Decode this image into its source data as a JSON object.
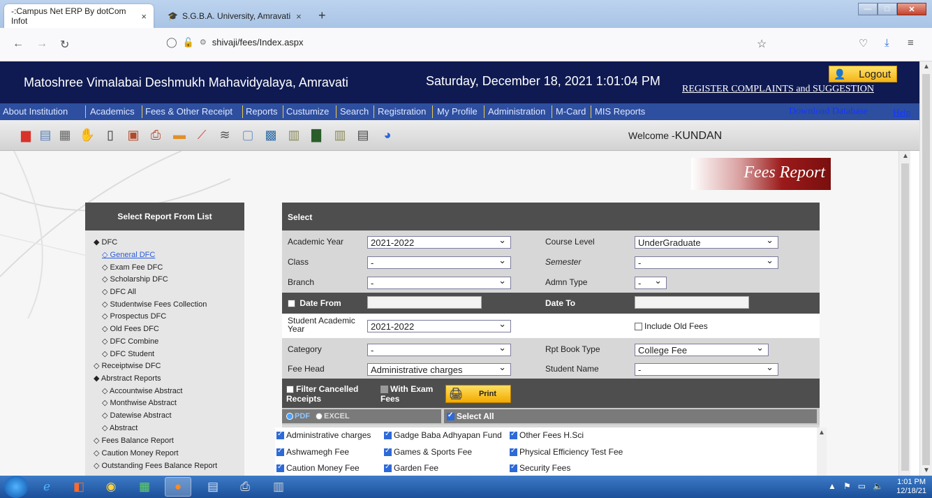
{
  "browser": {
    "tabs": [
      {
        "label": "-:Campus Net ERP By dotCom Infot",
        "close": "×"
      },
      {
        "label": "S.G.B.A. University, Amravati",
        "close": "×"
      }
    ],
    "new_tab": "+",
    "url": "shivaji/fees/Index.aspx"
  },
  "header": {
    "college": "Matoshree Vimalabai Deshmukh Mahavidyalaya, Amravati",
    "datetime": "Saturday, December 18, 2021 1:01:04 PM",
    "complaints": "REGISTER COMPLAINTS and SUGGESTION",
    "logout": "Logout"
  },
  "menu": {
    "items": [
      "About Institution",
      "Academics",
      "Fees & Other Receipt",
      "Reports",
      "Custumize",
      "Search",
      "Registration",
      "My Profile",
      "Administration",
      "M-Card",
      "MIS Reports"
    ],
    "download": "Download Database",
    "help": "Help"
  },
  "toolbar": {
    "welcome_prefix": "Welcome -",
    "user": "KUNDAN"
  },
  "page": {
    "title": "Fees Report"
  },
  "left_panel": {
    "title": "Select Report From List",
    "items": [
      {
        "label": "DFC",
        "bullet": "◆"
      },
      {
        "label": "General DFC",
        "bullet": "◇"
      },
      {
        "label": "Exam Fee DFC",
        "bullet": "◇"
      },
      {
        "label": "Scholarship DFC",
        "bullet": "◇"
      },
      {
        "label": "DFC All",
        "bullet": "◇"
      },
      {
        "label": "Studentwise Fees Collection",
        "bullet": "◇"
      },
      {
        "label": "Prospectus DFC",
        "bullet": "◇"
      },
      {
        "label": "Old Fees DFC",
        "bullet": "◇"
      },
      {
        "label": "DFC Combine",
        "bullet": "◇"
      },
      {
        "label": "DFC Student",
        "bullet": "◇"
      },
      {
        "label": "Receiptwise DFC",
        "bullet": "◇"
      },
      {
        "label": "Abrstract Reports",
        "bullet": "◆"
      },
      {
        "label": "Accountwise Abstract",
        "bullet": "◇"
      },
      {
        "label": "Monthwise Abstract",
        "bullet": "◇"
      },
      {
        "label": "Datewise Abstract",
        "bullet": "◇"
      },
      {
        "label": "Abstract",
        "bullet": "◇"
      },
      {
        "label": "Fees Balance Report",
        "bullet": "◇"
      },
      {
        "label": "Caution Money Report",
        "bullet": "◇"
      },
      {
        "label": "Outstanding Fees Balance Report",
        "bullet": "◇"
      }
    ]
  },
  "form": {
    "title": "Select",
    "academic_year": {
      "label": "Academic Year",
      "value": "2021-2022"
    },
    "course_level": {
      "label": "Course Level",
      "value": "UnderGraduate"
    },
    "class": {
      "label": "Class",
      "value": "-"
    },
    "semester": {
      "label": "Semester",
      "value": "-"
    },
    "branch": {
      "label": "Branch",
      "value": "-"
    },
    "admn_type": {
      "label": "Admn Type",
      "value": "-"
    },
    "date_from": {
      "label": "Date From"
    },
    "date_to": {
      "label": "Date To"
    },
    "student_academic_year": {
      "label": "Student Academic Year",
      "value": "2021-2022"
    },
    "include_old_fees": "Include Old Fees",
    "category": {
      "label": "Category",
      "value": "-"
    },
    "rpt_book_type": {
      "label": "Rpt Book Type",
      "value": "College Fee"
    },
    "fee_head": {
      "label": "Fee Head",
      "value": "Administrative charges"
    },
    "student_name": {
      "label": "Student Name",
      "value": "-"
    },
    "filter_cancelled": "Filter Cancelled Receipts",
    "with_exam_fees": "With Exam Fees",
    "print": "Print",
    "pdf": "PDF",
    "excel": "EXCEL",
    "select_all": "Select All"
  },
  "fees": [
    "Administrative charges",
    "Gadge Baba Adhyapan Fund",
    "Other Fees H.Sci",
    "Ashwamegh Fee",
    "Games & Sports Fee",
    "Physical Efficiency Test Fee",
    "Caution Money Fee",
    "Garden Fee",
    "Security Fees"
  ],
  "taskbar": {
    "time": "1:01 PM",
    "date": "12/18/21"
  },
  "colors": {
    "header_bg": "#0f1a52",
    "menu_bg": "#2e4f9f",
    "panel_head": "#4e4e4e",
    "banner_red": "#9b1a1a",
    "logout_yellow": "#f3b416"
  }
}
